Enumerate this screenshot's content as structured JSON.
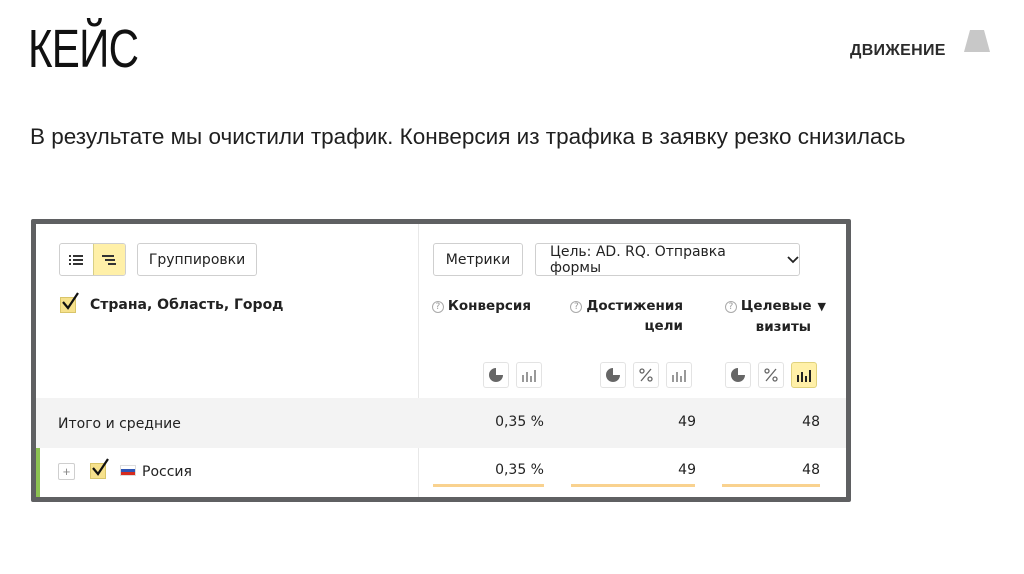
{
  "slide": {
    "title": "КЕЙС",
    "brand": "ДВИЖЕНИЕ",
    "lead": "В результате мы очистили трафик. Конверсия из трафика в заявку резко снизилась"
  },
  "toolbar": {
    "groupings_label": "Группировки",
    "metrics_label": "Метрики",
    "goal_label": "Цель: AD. RQ. Отправка формы"
  },
  "table": {
    "dimension_title": "Страна, Область, Город",
    "columns": [
      {
        "line1": "Конверсия",
        "line2": ""
      },
      {
        "line1": "Достижения",
        "line2": "цели"
      },
      {
        "line1": "Целевые",
        "line2": "визиты",
        "sort": "▼"
      }
    ],
    "total": {
      "label": "Итого и средние",
      "values": [
        "0,35 %",
        "49",
        "48"
      ]
    },
    "rows": [
      {
        "label": "Россия",
        "values": [
          "0,35 %",
          "49",
          "48"
        ],
        "bar_fraction": [
          1,
          1,
          1
        ]
      }
    ]
  },
  "colors": {
    "accent_yellow": "#fff0a8",
    "row_marker_green": "#8cc152",
    "bar_orange": "#f9d28f",
    "frame_gray": "#5f6062"
  },
  "icons": [
    "list-view-icon",
    "tree-view-icon",
    "chevron-down-icon",
    "help-icon",
    "pie-chart-icon",
    "percent-icon",
    "bar-chart-icon",
    "checkbox-check-icon",
    "russia-flag-icon",
    "expand-icon",
    "brand-logo-icon"
  ]
}
